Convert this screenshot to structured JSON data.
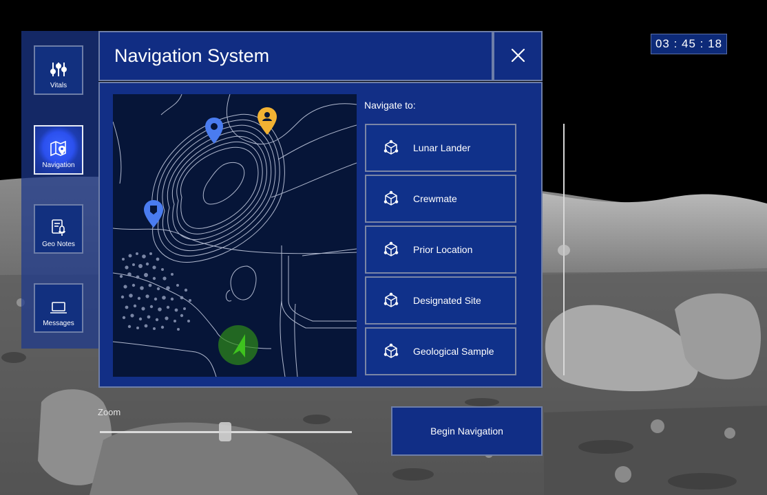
{
  "clock": {
    "time": "03 : 45 : 18"
  },
  "sidebar": {
    "items": [
      {
        "label": "Vitals",
        "icon": "sliders-icon",
        "active": false
      },
      {
        "label": "Navigation",
        "icon": "map-pin-icon",
        "active": true
      },
      {
        "label": "Geo Notes",
        "icon": "notes-mic-icon",
        "active": false
      },
      {
        "label": "Messages",
        "icon": "laptop-icon",
        "active": false
      }
    ]
  },
  "header": {
    "title": "Navigation System",
    "close_icon": "close-icon"
  },
  "navigate": {
    "heading": "Navigate to:",
    "destinations": [
      {
        "label": "Lunar Lander",
        "icon": "cube-icon"
      },
      {
        "label": "Crewmate",
        "icon": "cube-icon"
      },
      {
        "label": "Prior Location",
        "icon": "cube-icon"
      },
      {
        "label": "Designated Site",
        "icon": "cube-icon"
      },
      {
        "label": "Geological Sample",
        "icon": "cube-icon"
      }
    ]
  },
  "map": {
    "markers": [
      {
        "name": "waypoint-marker",
        "color": "#4a7cf0"
      },
      {
        "name": "crewmate-marker",
        "color": "#f2b233"
      },
      {
        "name": "lander-marker",
        "color": "#4a7cf0"
      },
      {
        "name": "current-position-marker",
        "color": "#3ec21e"
      }
    ]
  },
  "zoom": {
    "label": "Zoom",
    "level": 0.49
  },
  "vertical_slider": {
    "level": 0.51
  },
  "begin_button": {
    "label": "Begin Navigation"
  },
  "colors": {
    "panel": "#122f86",
    "border": "#6e7ea8",
    "accent": "#2b50ee"
  }
}
